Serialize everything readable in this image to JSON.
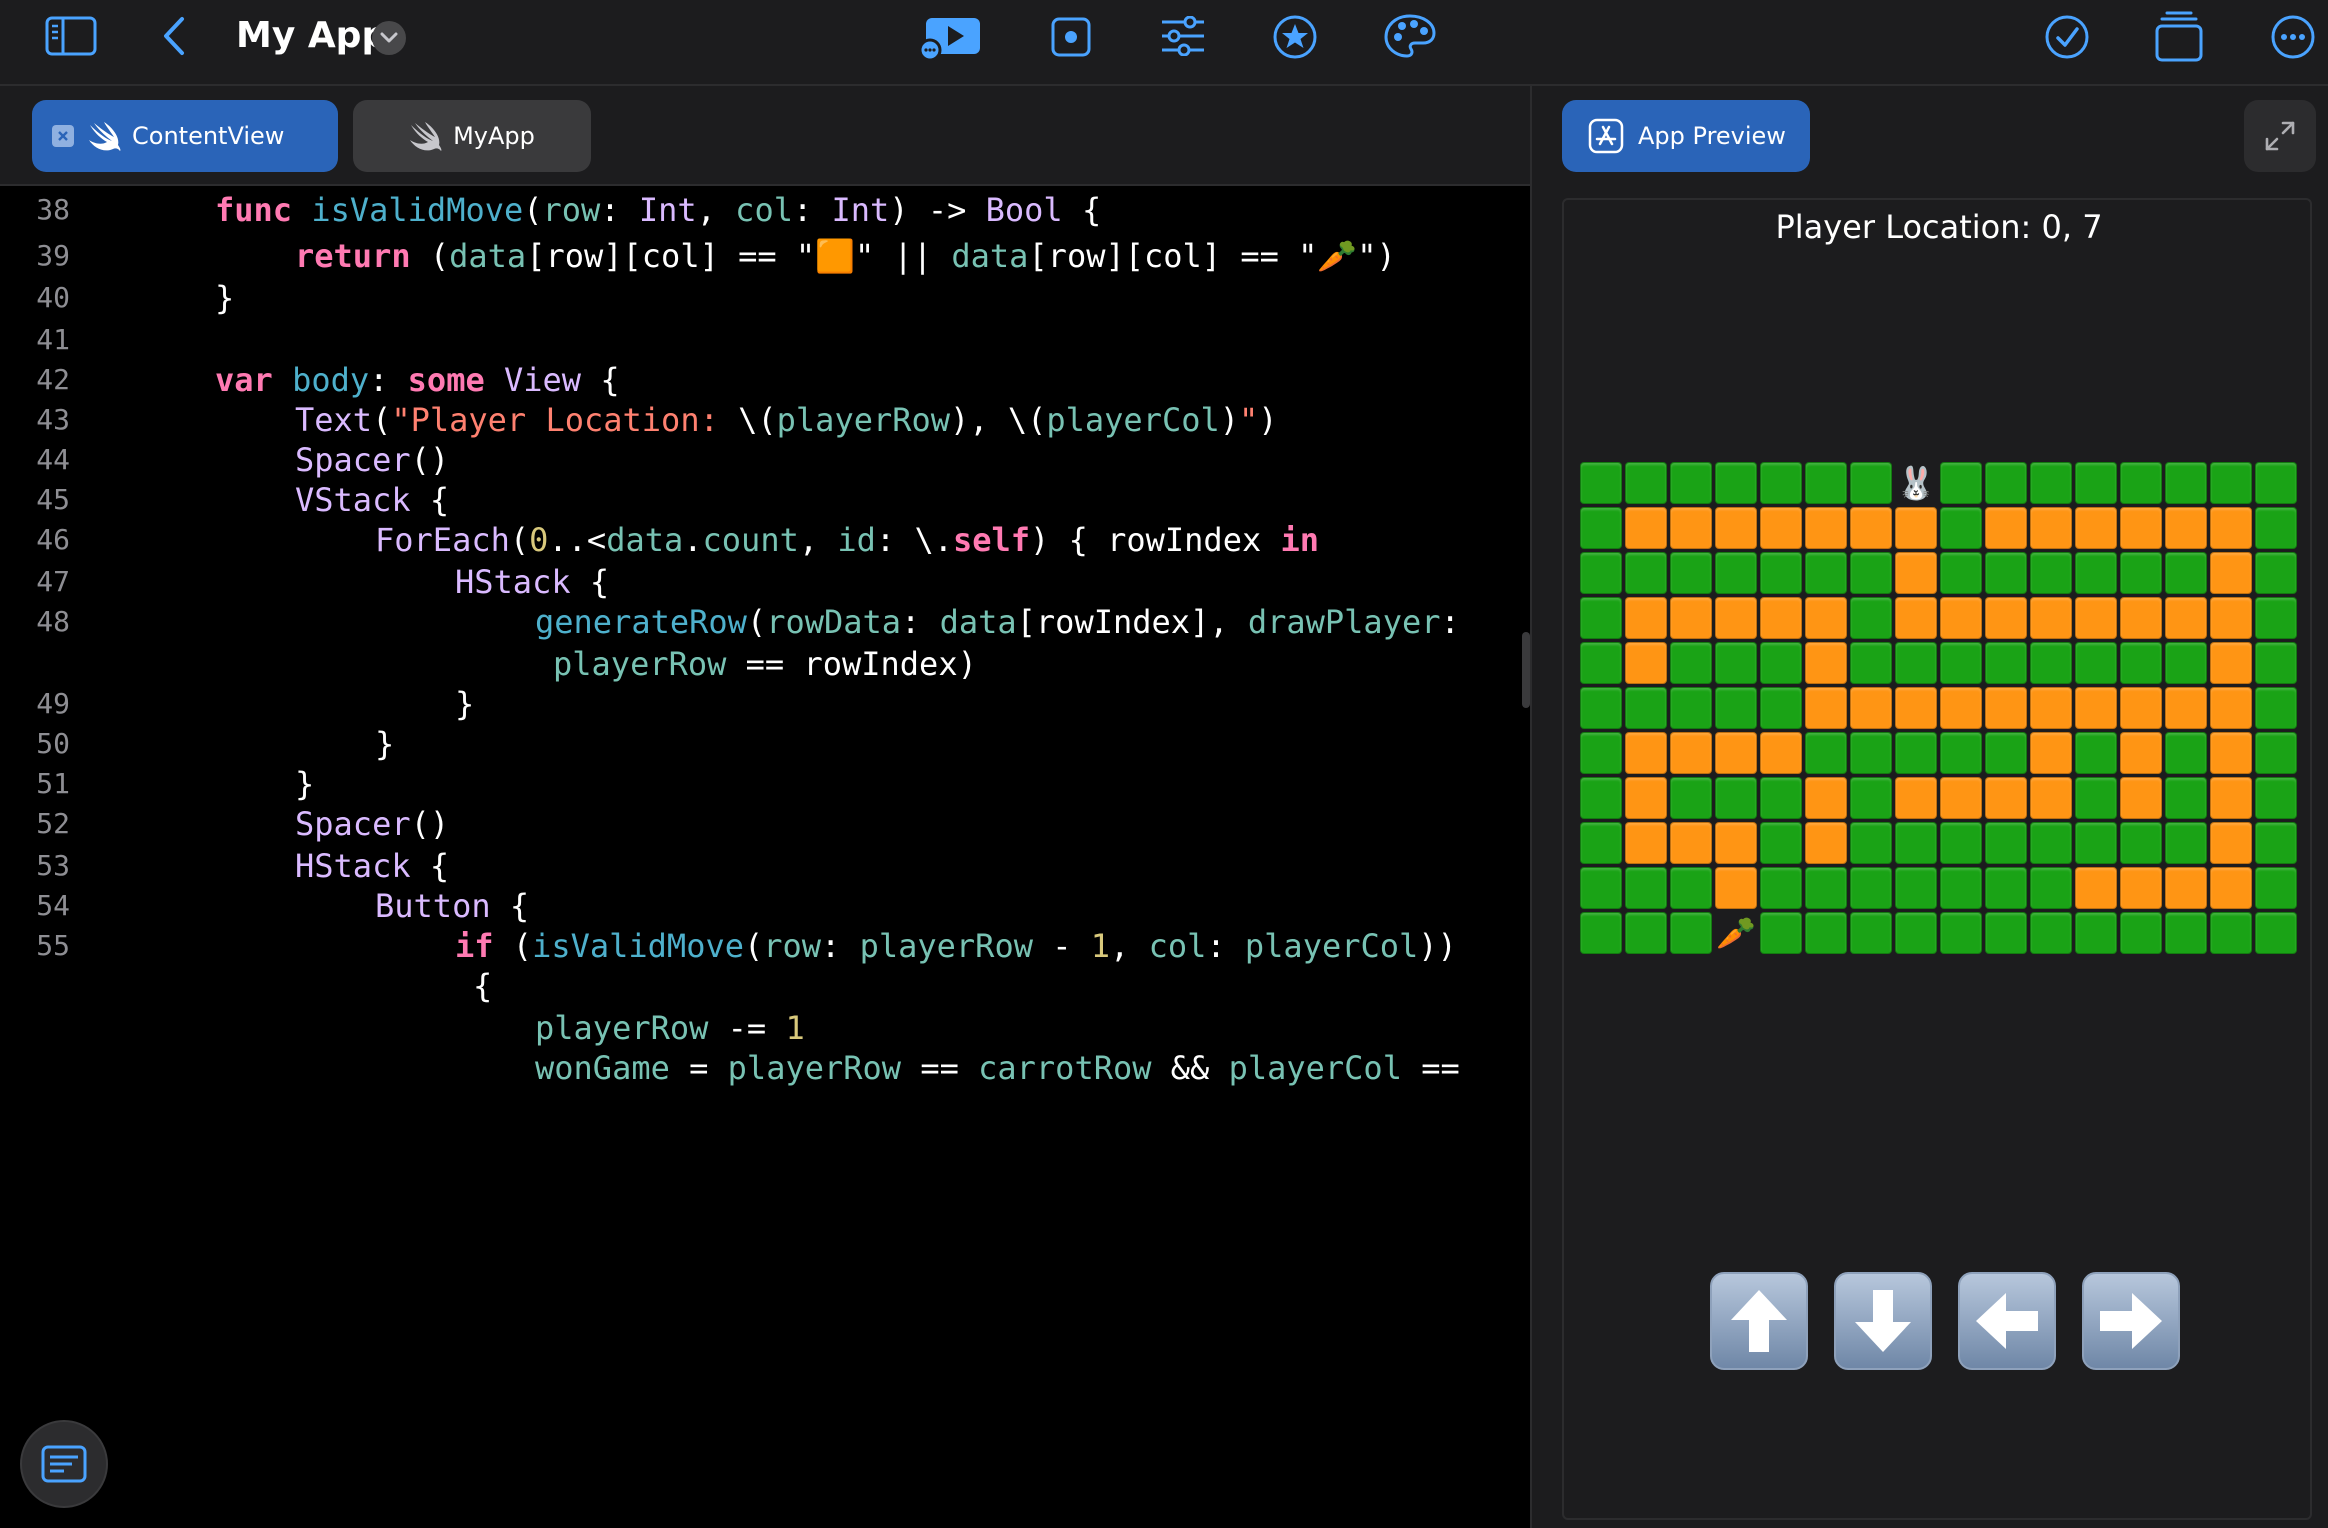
{
  "toolbar": {
    "title": "My App",
    "icons": [
      "sidebar-icon",
      "back-chevron-icon",
      "title-menu-chevron-icon",
      "run-app-icon",
      "record-icon",
      "settings-sliders-icon",
      "favorites-star-icon",
      "palette-icon",
      "checkmark-icon",
      "windows-icon",
      "more-icon"
    ]
  },
  "tabs": [
    {
      "label": "ContentView",
      "active": true
    },
    {
      "label": "MyApp",
      "active": false
    }
  ],
  "code_lines": [
    {
      "ln": "38",
      "indent": 1,
      "tokens": [
        [
          "kw",
          "func"
        ],
        [
          "p",
          " "
        ],
        [
          "fn",
          "isValidMove"
        ],
        [
          "p",
          "("
        ],
        [
          "pa",
          "row"
        ],
        [
          "p",
          ": "
        ],
        [
          "ty",
          "Int"
        ],
        [
          "p",
          ", "
        ],
        [
          "pa",
          "col"
        ],
        [
          "p",
          ": "
        ],
        [
          "ty",
          "Int"
        ],
        [
          "p",
          ") -> "
        ],
        [
          "ty",
          "Bool"
        ],
        [
          "p",
          " {"
        ]
      ]
    },
    {
      "ln": "39",
      "indent": 2,
      "tokens": [
        [
          "kw",
          "return"
        ],
        [
          "p",
          " ("
        ],
        [
          "pa",
          "data"
        ],
        [
          "p",
          "[row][col] == \""
        ],
        [
          "em",
          "🟧"
        ],
        [
          "p",
          "\" || "
        ],
        [
          "pa",
          "data"
        ],
        [
          "p",
          "[row][col] == \""
        ],
        [
          "em",
          "🥕"
        ],
        [
          "p",
          "\")"
        ]
      ]
    },
    {
      "ln": "40",
      "indent": 1,
      "tokens": [
        [
          "p",
          "}"
        ]
      ]
    },
    {
      "ln": "41",
      "indent": 0,
      "tokens": []
    },
    {
      "ln": "42",
      "indent": 1,
      "tokens": [
        [
          "kw",
          "var"
        ],
        [
          "p",
          " "
        ],
        [
          "fn",
          "body"
        ],
        [
          "p",
          ": "
        ],
        [
          "kw",
          "some"
        ],
        [
          "p",
          " "
        ],
        [
          "ty",
          "View"
        ],
        [
          "p",
          " {"
        ]
      ]
    },
    {
      "ln": "43",
      "indent": 2,
      "tokens": [
        [
          "ty",
          "Text"
        ],
        [
          "p",
          "("
        ],
        [
          "st",
          "\"Player Location: "
        ],
        [
          "p",
          "\\("
        ],
        [
          "pa",
          "playerRow"
        ],
        [
          "p",
          "),"
        ],
        [
          "st",
          " "
        ],
        [
          "p",
          "\\("
        ],
        [
          "pa",
          "playerCol"
        ],
        [
          "p",
          ")"
        ],
        [
          "st",
          "\""
        ],
        [
          "p",
          ")"
        ]
      ]
    },
    {
      "ln": "44",
      "indent": 2,
      "tokens": [
        [
          "ty",
          "Spacer"
        ],
        [
          "p",
          "()"
        ]
      ]
    },
    {
      "ln": "45",
      "indent": 2,
      "tokens": [
        [
          "ty",
          "VStack"
        ],
        [
          "p",
          " {"
        ]
      ]
    },
    {
      "ln": "46",
      "indent": 3,
      "tokens": [
        [
          "ty",
          "ForEach"
        ],
        [
          "p",
          "("
        ],
        [
          "nu",
          "0"
        ],
        [
          "p",
          "..<"
        ],
        [
          "pa",
          "data"
        ],
        [
          "p",
          "."
        ],
        [
          "pa",
          "count"
        ],
        [
          "p",
          ", "
        ],
        [
          "pa",
          "id"
        ],
        [
          "p",
          ": \\."
        ],
        [
          "kw",
          "self"
        ],
        [
          "p",
          ") { rowIndex "
        ],
        [
          "kw",
          "in"
        ]
      ]
    },
    {
      "ln": "47",
      "indent": 4,
      "tokens": [
        [
          "ty",
          "HStack"
        ],
        [
          "p",
          " {"
        ]
      ]
    },
    {
      "ln": "48",
      "indent": 5,
      "tokens": [
        [
          "fn",
          "generateRow"
        ],
        [
          "p",
          "("
        ],
        [
          "pa",
          "rowData"
        ],
        [
          "p",
          ": "
        ],
        [
          "pa",
          "data"
        ],
        [
          "p",
          "[rowIndex], "
        ],
        [
          "pa",
          "drawPlayer"
        ],
        [
          "p",
          ":"
        ]
      ]
    },
    {
      "ln": "",
      "indent": 5,
      "pad": " ",
      "tokens": [
        [
          "pa",
          "playerRow"
        ],
        [
          "p",
          " == rowIndex)"
        ]
      ]
    },
    {
      "ln": "49",
      "indent": 4,
      "tokens": [
        [
          "p",
          "}"
        ]
      ]
    },
    {
      "ln": "50",
      "indent": 3,
      "tokens": [
        [
          "p",
          "}"
        ]
      ]
    },
    {
      "ln": "51",
      "indent": 2,
      "tokens": [
        [
          "p",
          "}"
        ]
      ]
    },
    {
      "ln": "52",
      "indent": 2,
      "tokens": [
        [
          "ty",
          "Spacer"
        ],
        [
          "p",
          "()"
        ]
      ]
    },
    {
      "ln": "53",
      "indent": 2,
      "tokens": [
        [
          "ty",
          "HStack"
        ],
        [
          "p",
          " {"
        ]
      ]
    },
    {
      "ln": "54",
      "indent": 3,
      "tokens": [
        [
          "ty",
          "Button"
        ],
        [
          "p",
          " {"
        ]
      ]
    },
    {
      "ln": "55",
      "indent": 4,
      "tokens": [
        [
          "kw",
          "if"
        ],
        [
          "p",
          " ("
        ],
        [
          "fn",
          "isValidMove"
        ],
        [
          "p",
          "("
        ],
        [
          "pa",
          "row"
        ],
        [
          "p",
          ": "
        ],
        [
          "pa",
          "playerRow"
        ],
        [
          "p",
          " - "
        ],
        [
          "nu",
          "1"
        ],
        [
          "p",
          ", "
        ],
        [
          "pa",
          "col"
        ],
        [
          "p",
          ": "
        ],
        [
          "pa",
          "playerCol"
        ],
        [
          "p",
          "))"
        ]
      ]
    },
    {
      "ln": "",
      "indent": 4,
      "pad": " ",
      "tokens": [
        [
          "p",
          "{"
        ]
      ]
    },
    {
      "ln": "",
      "indent": 5,
      "tokens": [
        [
          "pa",
          "playerRow"
        ],
        [
          "p",
          " -= "
        ],
        [
          "nu",
          "1"
        ]
      ]
    },
    {
      "ln": "",
      "indent": 5,
      "tokens": [
        [
          "pa",
          "wonGame"
        ],
        [
          "p",
          " = "
        ],
        [
          "pa",
          "playerRow"
        ],
        [
          "p",
          " == "
        ],
        [
          "pa",
          "carrotRow"
        ],
        [
          "p",
          " && "
        ],
        [
          "pa",
          "playerCol"
        ],
        [
          "p",
          " =="
        ]
      ]
    }
  ],
  "preview": {
    "tab_label": "App Preview",
    "player_location": "Player Location: 0, 7",
    "player_emoji": "🐰",
    "carrot_emoji": "🥕",
    "grid": [
      "GGGGGGG@GGGGGGGG",
      "GOOOOOOOGOOOOOOG",
      "GGGGGGGOGGGGGGOG",
      "GOOOOOGOOOOOOOOG",
      "GOGGGOGGGGGGGGOG",
      "GGGGGOOOOOOOOOOG",
      "GOOOOGGGGGOGOGOG",
      "GOGGGOGOOOOGOGOG",
      "GOOOGOGGGGGGGGOG",
      "GGGOGGGGGGGOOOOG",
      "GGG#GGGGGGGGGGGG"
    ],
    "arrows": [
      "up-arrow-icon",
      "down-arrow-icon",
      "left-arrow-icon",
      "right-arrow-icon"
    ]
  },
  "colors": {
    "accent": "#2a64b8",
    "wall": "#1aa316",
    "path": "#ff9514",
    "keyword": "#ff7ab2",
    "function": "#4eb0cc",
    "type": "#dabaff",
    "param": "#78c2b3",
    "string": "#ff8170",
    "number": "#d9c97c"
  }
}
